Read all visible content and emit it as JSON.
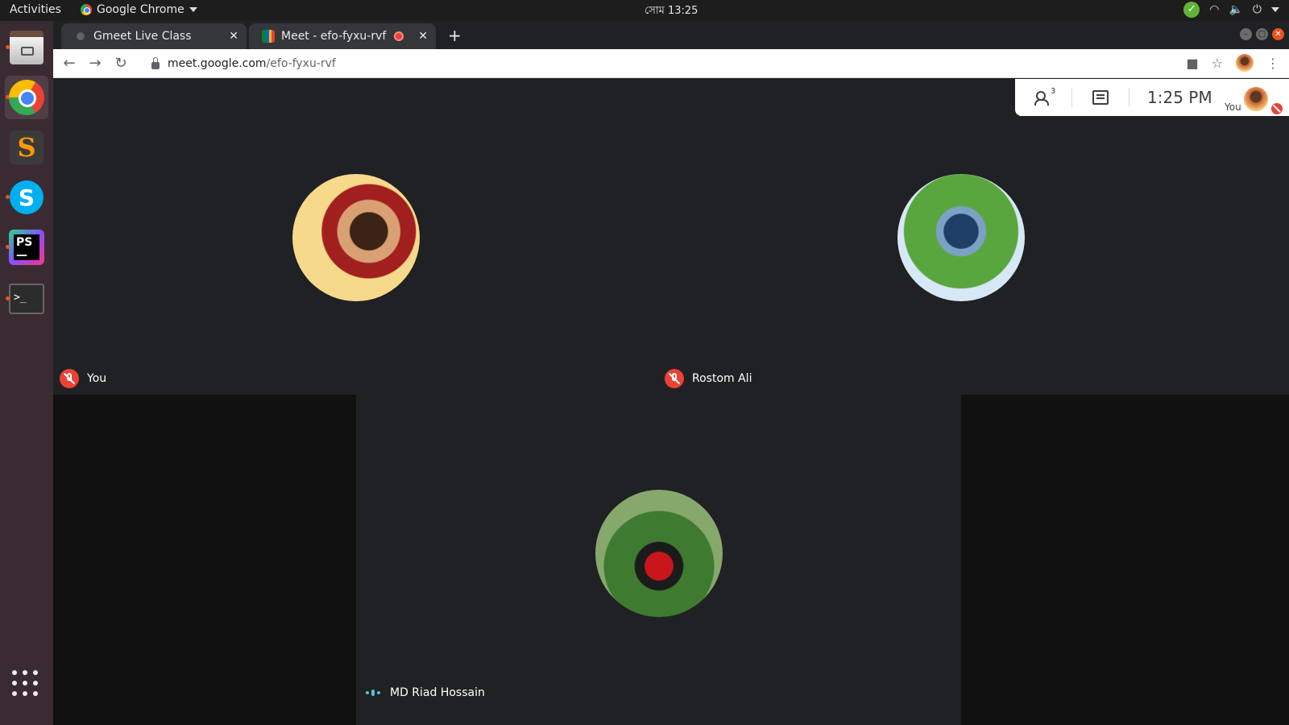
{
  "system": {
    "activities": "Activities",
    "app_name": "Google Chrome",
    "clock": "সোম 13:25"
  },
  "browser": {
    "tabs": [
      {
        "title": "Gmeet Live Class",
        "active": false
      },
      {
        "title": "Meet - efo-fyxu-rvf",
        "active": true
      }
    ],
    "url_host": "meet.google.com",
    "url_path": "/efo-fyxu-rvf"
  },
  "meet": {
    "people_count": "3",
    "time": "1:25 PM",
    "self_label": "You",
    "participants": [
      {
        "name": "You",
        "muted": true
      },
      {
        "name": "Rostom Ali",
        "muted": true
      },
      {
        "name": "MD Riad Hossain",
        "muted": false,
        "speaking": true
      }
    ]
  },
  "colors": {
    "meet_bg": "#202124",
    "mute_red": "#ea4335",
    "dock_bg": "#3a2b33",
    "accent_orange": "#e95420"
  },
  "icons": {
    "dock": [
      "files-icon",
      "chrome-icon",
      "sublime-text-icon",
      "skype-icon",
      "phpstorm-icon",
      "terminal-icon",
      "show-apps-icon"
    ]
  }
}
